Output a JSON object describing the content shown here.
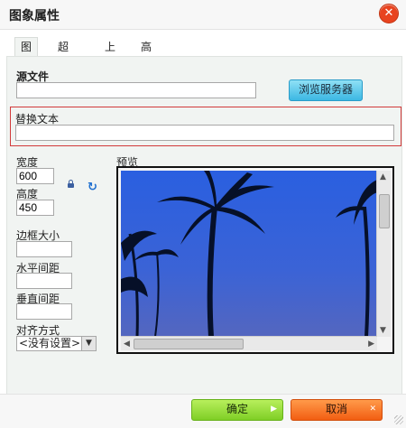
{
  "dialog": {
    "title": "图象属性"
  },
  "tabs": [
    {
      "label": "图象",
      "active": true
    },
    {
      "label": "超链接",
      "active": false
    },
    {
      "label": "上传",
      "active": false
    },
    {
      "label": "高级",
      "active": false
    }
  ],
  "source": {
    "label": "源文件",
    "value": "",
    "browse_label": "浏览服务器"
  },
  "alt": {
    "label": "替换文本",
    "value": ""
  },
  "width": {
    "label": "宽度",
    "value": "600"
  },
  "height": {
    "label": "高度",
    "value": "450"
  },
  "border": {
    "label": "边框大小",
    "value": ""
  },
  "hspace": {
    "label": "水平间距",
    "value": ""
  },
  "vspace": {
    "label": "垂直间距",
    "value": ""
  },
  "align": {
    "label": "对齐方式",
    "selected": "<没有设置>"
  },
  "preview": {
    "label": "预览"
  },
  "buttons": {
    "ok": "确定",
    "cancel": "取消"
  },
  "colors": {
    "ok": "#8fd83a",
    "cancel": "#f26a20",
    "browse": "#4fc3ea",
    "close": "#e8431f"
  }
}
